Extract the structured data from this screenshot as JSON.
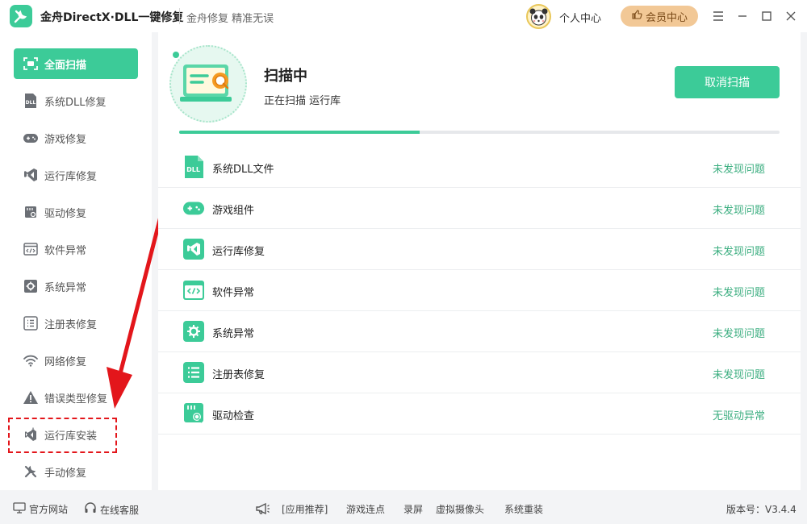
{
  "title_bar": {
    "app_title": "金舟DirectX·DLL一键修复",
    "slogan": "金舟修复 精准无误",
    "personal_center": "个人中心",
    "vip_center": "会员中心"
  },
  "sidebar": {
    "items": [
      {
        "label": "全面扫描",
        "icon": "scan-icon",
        "active": true
      },
      {
        "label": "系统DLL修复",
        "icon": "dll-icon",
        "active": false
      },
      {
        "label": "游戏修复",
        "icon": "gamepad-icon",
        "active": false
      },
      {
        "label": "运行库修复",
        "icon": "visual-studio-icon",
        "active": false
      },
      {
        "label": "驱动修复",
        "icon": "driver-chip-icon",
        "active": false
      },
      {
        "label": "软件异常",
        "icon": "code-window-icon",
        "active": false
      },
      {
        "label": "系统异常",
        "icon": "gear-icon",
        "active": false
      },
      {
        "label": "注册表修复",
        "icon": "list-icon",
        "active": false
      },
      {
        "label": "网络修复",
        "icon": "wifi-icon",
        "active": false
      },
      {
        "label": "错误类型修复",
        "icon": "warning-icon",
        "active": false
      },
      {
        "label": "运行库安装",
        "icon": "install-runtime-icon",
        "active": false
      },
      {
        "label": "手动修复",
        "icon": "wrench-icon",
        "active": false
      }
    ]
  },
  "scan": {
    "title": "扫描中",
    "subtitle": "正在扫描 运行库",
    "cancel_label": "取消扫描",
    "progress_percent": 40
  },
  "results": [
    {
      "name": "系统DLL文件",
      "status": "未发现问题",
      "icon": "dll-file-icon"
    },
    {
      "name": "游戏组件",
      "status": "未发现问题",
      "icon": "gamepad-icon"
    },
    {
      "name": "运行库修复",
      "status": "未发现问题",
      "icon": "visual-studio-icon"
    },
    {
      "name": "软件异常",
      "status": "未发现问题",
      "icon": "code-window-icon"
    },
    {
      "name": "系统异常",
      "status": "未发现问题",
      "icon": "gear-icon"
    },
    {
      "name": "注册表修复",
      "status": "未发现问题",
      "icon": "list-icon"
    },
    {
      "name": "驱动检查",
      "status": "无驱动异常",
      "icon": "driver-chip-icon"
    }
  ],
  "footer": {
    "official_site": "官方网站",
    "online_service": "在线客服",
    "app_recommend": "[应用推荐]",
    "links": [
      "游戏连点",
      "录屏",
      "虚拟摄像头",
      "系统重装"
    ],
    "version": "版本号：V3.4.4"
  },
  "colors": {
    "accent": "#3ccb98",
    "status_ok": "#3cae80",
    "vip": "#f2c896",
    "annotation_red": "#e3161b"
  }
}
